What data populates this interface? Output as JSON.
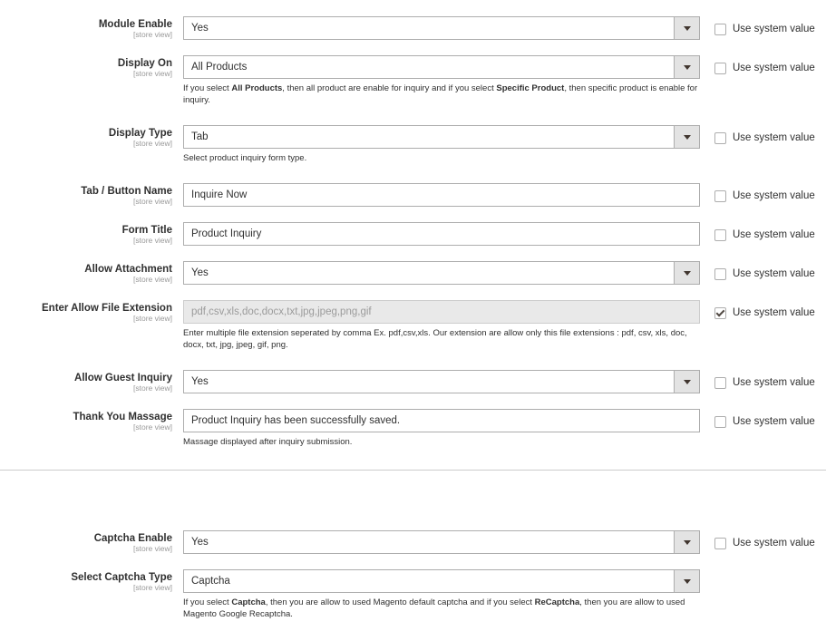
{
  "store_view_label": "[store view]",
  "use_system_value_label": "Use system value",
  "fields": {
    "module_enable": {
      "label": "Module Enable",
      "value": "Yes",
      "use_system": false
    },
    "display_on": {
      "label": "Display On",
      "value": "All Products",
      "use_system": false,
      "note": {
        "p1": "If you select ",
        "b1": "All Products",
        "p2": ", then all product are enable for inquiry and if you select ",
        "b2": "Specific Product",
        "p3": ", then specific product is enable for inquiry."
      }
    },
    "display_type": {
      "label": "Display Type",
      "value": "Tab",
      "use_system": false,
      "note": "Select product inquiry form type."
    },
    "tab_button_name": {
      "label": "Tab / Button Name",
      "value": "Inquire Now",
      "use_system": false
    },
    "form_title": {
      "label": "Form Title",
      "value": "Product Inquiry",
      "use_system": false
    },
    "allow_attachment": {
      "label": "Allow Attachment",
      "value": "Yes",
      "use_system": false
    },
    "file_extension": {
      "label": "Enter Allow File Extension",
      "value": "pdf,csv,xls,doc,docx,txt,jpg,jpeg,png,gif",
      "use_system": true,
      "note": "Enter multiple file extension seperated by comma Ex. pdf,csv,xls. Our extension are allow only this file extensions : pdf, csv, xls, doc, docx, txt, jpg, jpeg, gif, png."
    },
    "allow_guest_inquiry": {
      "label": "Allow Guest Inquiry",
      "value": "Yes",
      "use_system": false
    },
    "thank_you_message": {
      "label": "Thank You Massage",
      "value": "Product Inquiry has been successfully saved.",
      "use_system": false,
      "note": "Massage displayed after inquiry submission."
    },
    "captcha_enable": {
      "label": "Captcha Enable",
      "value": "Yes",
      "use_system": false
    },
    "captcha_type": {
      "label": "Select Captcha Type",
      "value": "Captcha",
      "note": {
        "p1": "If you select ",
        "b1": "Captcha",
        "p2": ", then you are allow to used Magento default captcha and if you select ",
        "b2": "ReCaptcha",
        "p3": ", then you are allow to used Magento Google Recaptcha."
      }
    }
  }
}
